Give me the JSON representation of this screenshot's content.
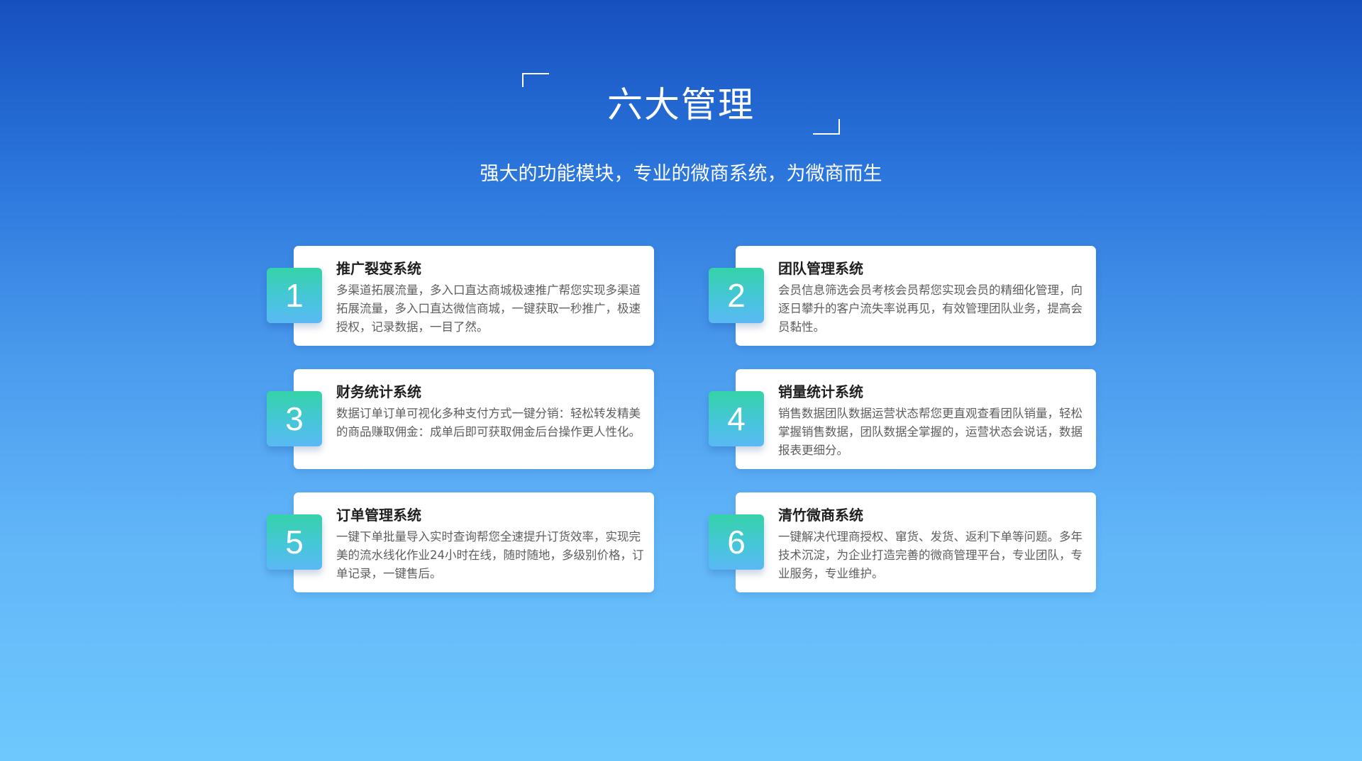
{
  "header": {
    "title": "六大管理",
    "subtitle": "强大的功能模块，专业的微商系统，为微商而生"
  },
  "cards": [
    {
      "number": "1",
      "title": "推广裂变系统",
      "description": "多渠道拓展流量，多入口直达商城极速推广帮您实现多渠道拓展流量，多入口直达微信商城，一键获取一秒推广，极速授权，记录数据，一目了然。"
    },
    {
      "number": "2",
      "title": "团队管理系统",
      "description": "会员信息筛选会员考核会员帮您实现会员的精细化管理，向逐日攀升的客户流失率说再见，有效管理团队业务，提高会员黏性。"
    },
    {
      "number": "3",
      "title": "财务统计系统",
      "description": "数据订单订单可视化多种支付方式一键分销：轻松转发精美的商品赚取佣金：成单后即可获取佣金后台操作更人性化。"
    },
    {
      "number": "4",
      "title": "销量统计系统",
      "description": "销售数据团队数据运营状态帮您更直观查看团队销量，轻松掌握销售数据，团队数据全掌握的，运营状态会说话，数据报表更细分。"
    },
    {
      "number": "5",
      "title": "订单管理系统",
      "description": "一键下单批量导入实时查询帮您全速提升订货效率，实现完美的流水线化作业24小时在线，随时随地，多级别价格，订单记录，一键售后。"
    },
    {
      "number": "6",
      "title": "清竹微商系统",
      "description": "一键解决代理商授权、窜货、发货、返利下单等问题。多年技术沉淀，为企业打造完善的微商管理平台，专业团队，专业服务，专业维护。"
    }
  ]
}
